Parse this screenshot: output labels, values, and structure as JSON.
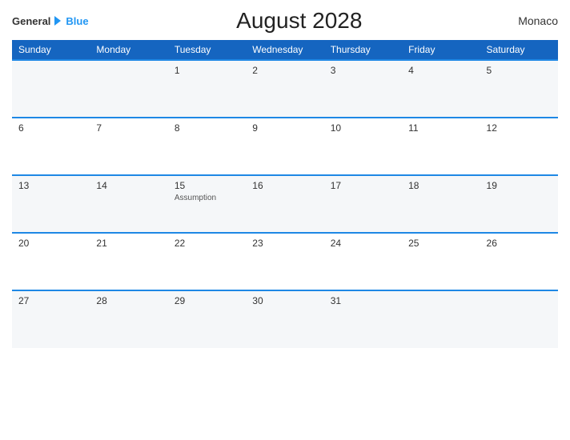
{
  "header": {
    "logo_general": "General",
    "logo_blue": "Blue",
    "title": "August 2028",
    "country": "Monaco"
  },
  "weekdays": [
    "Sunday",
    "Monday",
    "Tuesday",
    "Wednesday",
    "Thursday",
    "Friday",
    "Saturday"
  ],
  "weeks": [
    [
      {
        "day": "",
        "event": ""
      },
      {
        "day": "",
        "event": ""
      },
      {
        "day": "1",
        "event": ""
      },
      {
        "day": "2",
        "event": ""
      },
      {
        "day": "3",
        "event": ""
      },
      {
        "day": "4",
        "event": ""
      },
      {
        "day": "5",
        "event": ""
      }
    ],
    [
      {
        "day": "6",
        "event": ""
      },
      {
        "day": "7",
        "event": ""
      },
      {
        "day": "8",
        "event": ""
      },
      {
        "day": "9",
        "event": ""
      },
      {
        "day": "10",
        "event": ""
      },
      {
        "day": "11",
        "event": ""
      },
      {
        "day": "12",
        "event": ""
      }
    ],
    [
      {
        "day": "13",
        "event": ""
      },
      {
        "day": "14",
        "event": ""
      },
      {
        "day": "15",
        "event": "Assumption"
      },
      {
        "day": "16",
        "event": ""
      },
      {
        "day": "17",
        "event": ""
      },
      {
        "day": "18",
        "event": ""
      },
      {
        "day": "19",
        "event": ""
      }
    ],
    [
      {
        "day": "20",
        "event": ""
      },
      {
        "day": "21",
        "event": ""
      },
      {
        "day": "22",
        "event": ""
      },
      {
        "day": "23",
        "event": ""
      },
      {
        "day": "24",
        "event": ""
      },
      {
        "day": "25",
        "event": ""
      },
      {
        "day": "26",
        "event": ""
      }
    ],
    [
      {
        "day": "27",
        "event": ""
      },
      {
        "day": "28",
        "event": ""
      },
      {
        "day": "29",
        "event": ""
      },
      {
        "day": "30",
        "event": ""
      },
      {
        "day": "31",
        "event": ""
      },
      {
        "day": "",
        "event": ""
      },
      {
        "day": "",
        "event": ""
      }
    ]
  ]
}
